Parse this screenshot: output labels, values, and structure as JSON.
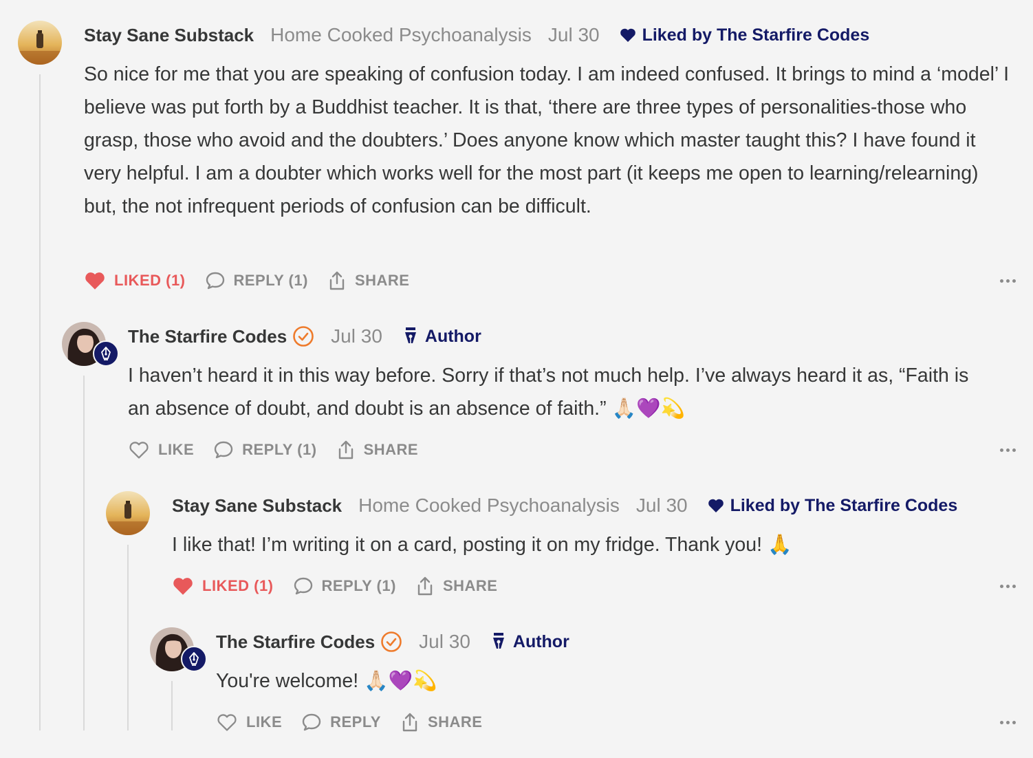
{
  "comments": [
    {
      "author": "Stay Sane Substack",
      "publication": "Home Cooked Psychoanalysis",
      "date": "Jul 30",
      "liked_by": "Liked by The Starfire Codes",
      "body": "So nice for me that you are speaking of confusion today. I am indeed confused. It brings to mind a ‘model’ I believe was put forth by a Buddhist teacher. It is that, ‘there are three types of personalities-those who grasp, those who avoid and the doubters.’ Does anyone know which master taught this? I have found it very helpful. I am a doubter which works well for the most part (it keeps me open to learning/relearning) but, the not infrequent periods of confusion can be difficult.",
      "like_label": "LIKED (1)",
      "reply_label": "REPLY (1)",
      "share_label": "SHARE"
    },
    {
      "author": "The Starfire Codes",
      "date": "Jul 30",
      "author_tag": "Author",
      "body": "I haven’t heard it in this way before. Sorry if that’s not much help. I’ve always heard it as, “Faith is an absence of doubt, and doubt is an absence of faith.” 🙏🏻💜💫",
      "like_label": "LIKE",
      "reply_label": "REPLY (1)",
      "share_label": "SHARE"
    },
    {
      "author": "Stay Sane Substack",
      "publication": "Home Cooked Psychoanalysis",
      "date": "Jul 30",
      "liked_by": "Liked by The Starfire Codes",
      "body": "I like that! I’m writing it on a card, posting it on my fridge. Thank you! 🙏",
      "like_label": "LIKED (1)",
      "reply_label": "REPLY (1)",
      "share_label": "SHARE"
    },
    {
      "author": "The Starfire Codes",
      "date": "Jul 30",
      "author_tag": "Author",
      "body": "You're welcome! 🙏🏻💜💫",
      "like_label": "LIKE",
      "reply_label": "REPLY",
      "share_label": "SHARE"
    }
  ],
  "colors": {
    "background": "#f4f4f4",
    "text": "#363737",
    "muted": "#8b8b8b",
    "liked": "#e8595a",
    "brand_navy": "#141a66",
    "verified_orange": "#ee7b2c"
  },
  "icons": [
    "heart-filled-icon",
    "heart-outline-icon",
    "reply-bubble-icon",
    "share-icon",
    "more-dots-icon",
    "verified-check-icon",
    "pen-nib-icon"
  ]
}
